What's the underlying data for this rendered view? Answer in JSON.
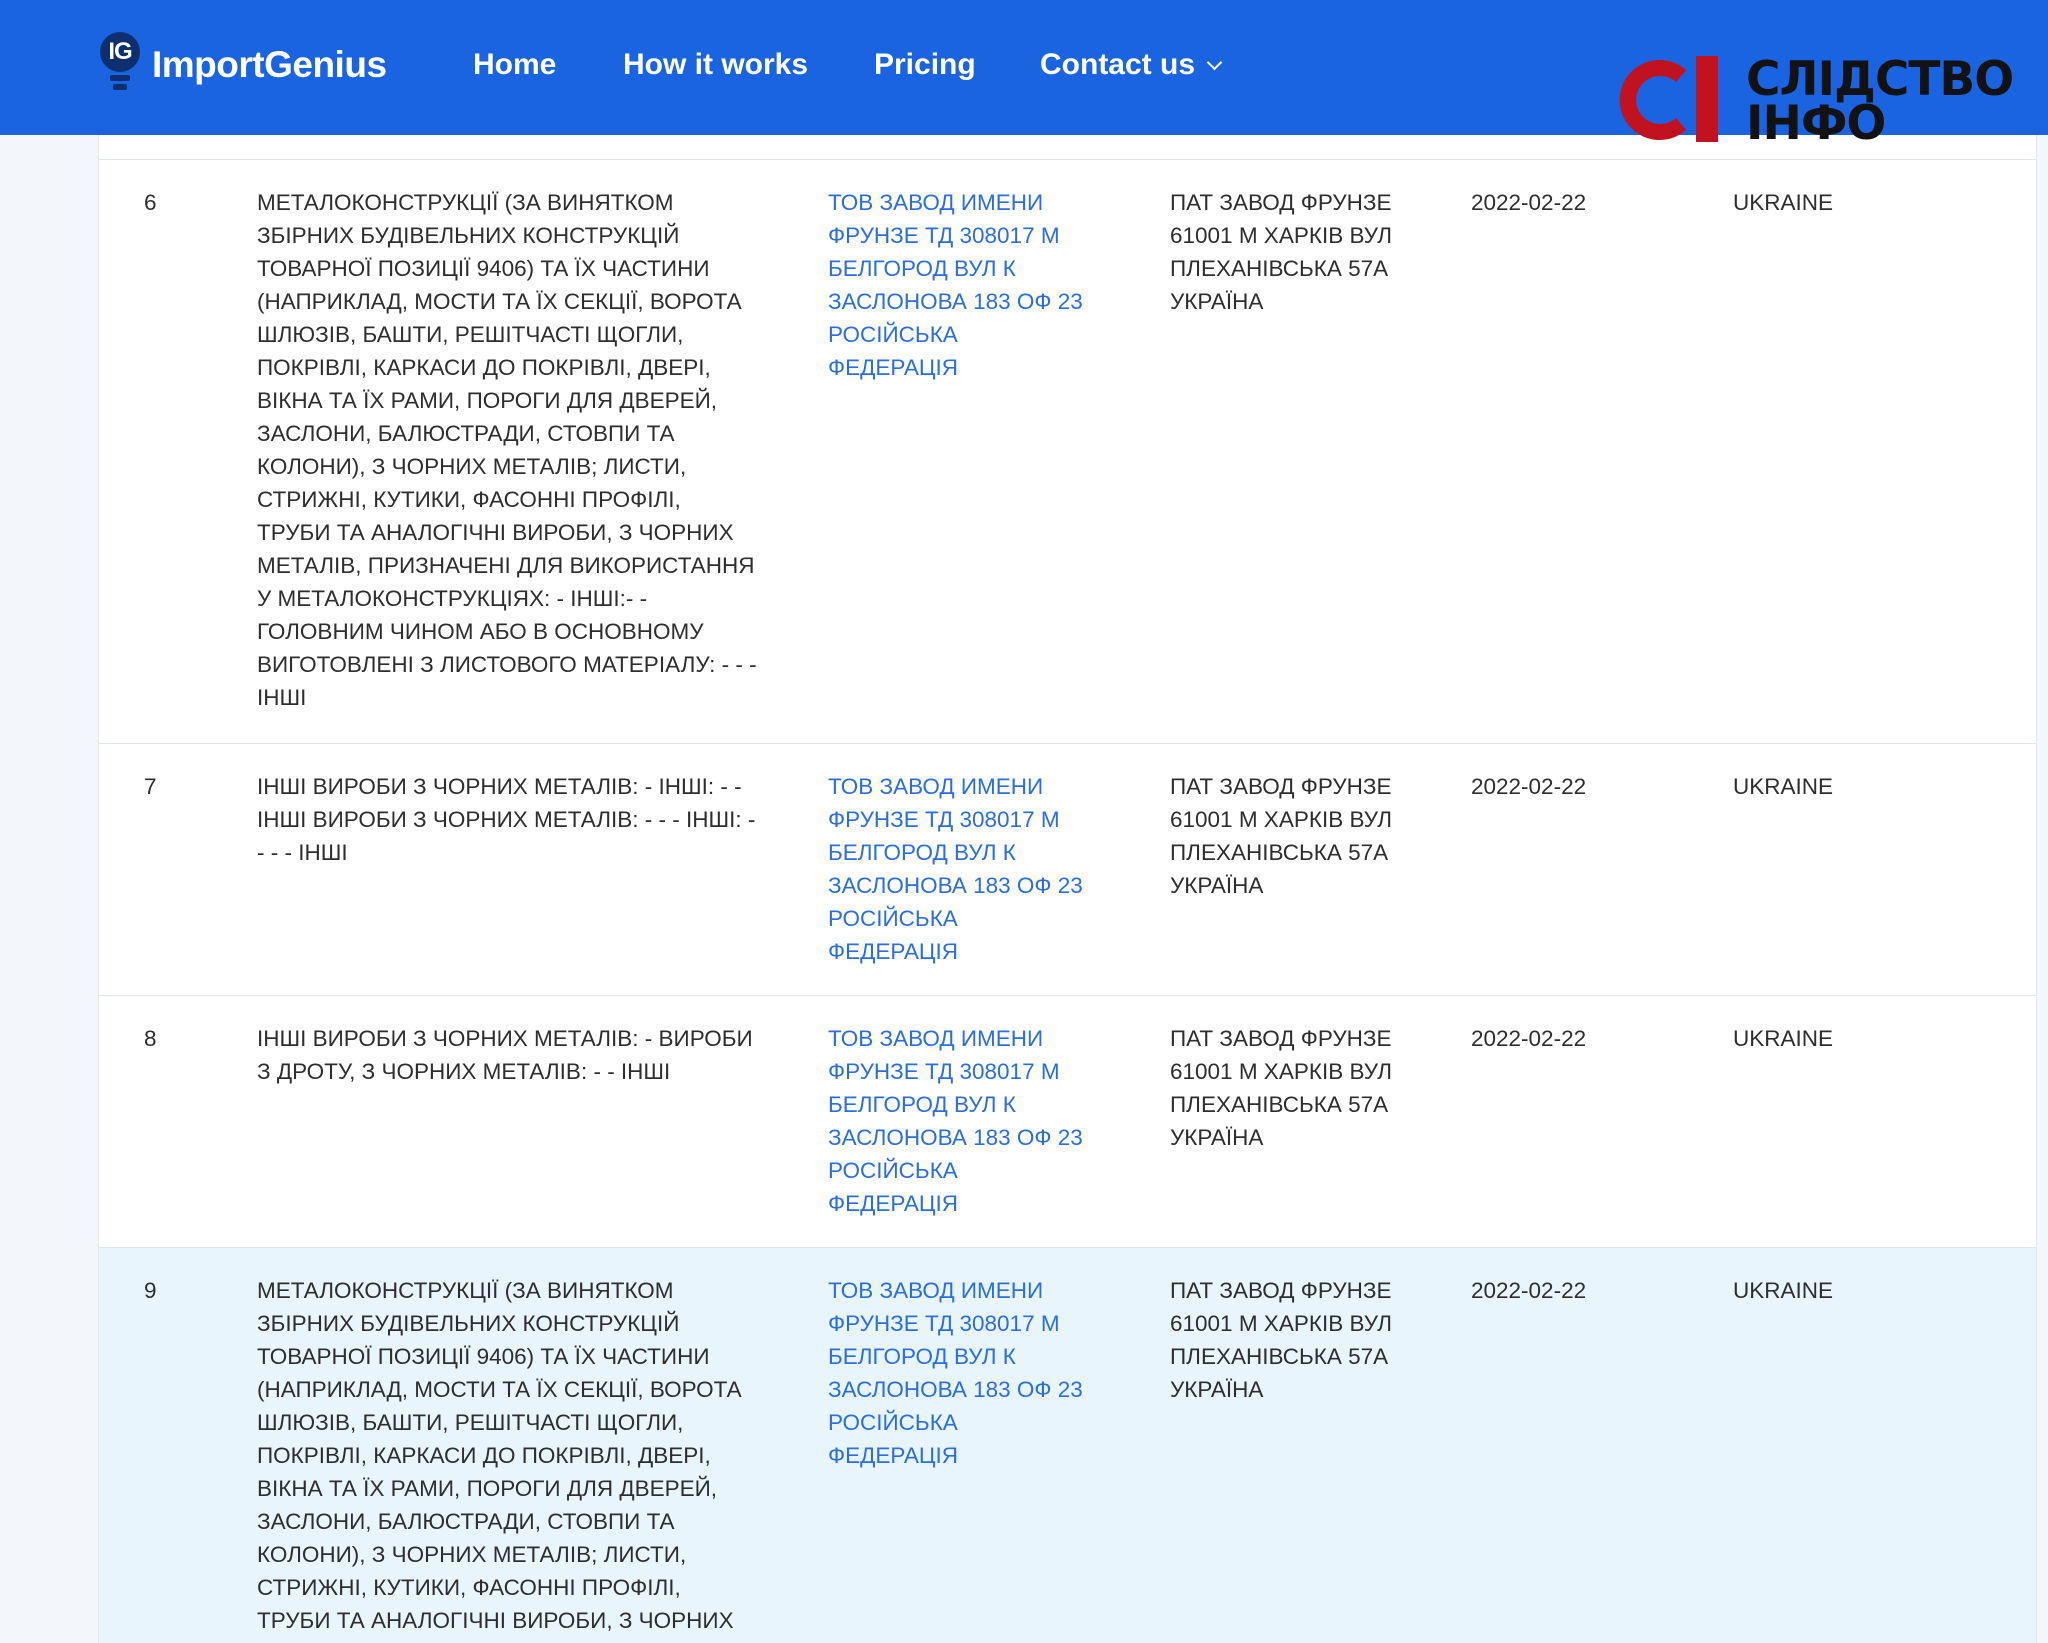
{
  "brand": {
    "badge": "IG",
    "name": "ImportGenius"
  },
  "nav": [
    {
      "label": "Home"
    },
    {
      "label": "How it works"
    },
    {
      "label": "Pricing"
    },
    {
      "label": "Contact us"
    }
  ],
  "watermark": {
    "line1": "СЛІДСТВО",
    "line2": "ІНФО",
    "accent_color": "#c1121f"
  },
  "colors": {
    "nav_bg": "#1a64e2",
    "link": "#2a6ee0",
    "highlight_row": "#e9f5fd"
  },
  "rows": [
    {
      "no": "6",
      "description": "МЕТАЛОКОНСТРУКЦІЇ (ЗА ВИНЯТКОМ ЗБІРНИХ БУДІВЕЛЬНИХ КОНСТРУКЦІЙ ТОВАРНОЇ ПОЗИЦІЇ 9406) ТА ЇХ ЧАСТИНИ (НАПРИКЛАД, МОСТИ ТА ЇХ СЕКЦІЇ, ВОРОТА ШЛЮЗІВ, БАШТИ, РЕШІТЧАСТІ ЩОГЛИ, ПОКРІВЛІ, КАРКАСИ ДО ПОКРІВЛІ, ДВЕРІ, ВІКНА ТА ЇХ РАМИ, ПОРОГИ ДЛЯ ДВЕРЕЙ, ЗАСЛОНИ, БАЛЮСТРАДИ, СТОВПИ ТА КОЛОНИ), З ЧОРНИХ МЕТАЛІВ; ЛИСТИ, СТРИЖНІ, КУТИКИ, ФАСОННІ ПРОФІЛІ, ТРУБИ ТА АНАЛОГІЧНІ ВИРОБИ, З ЧОРНИХ МЕТАЛІВ, ПРИЗНАЧЕНІ ДЛЯ ВИКОРИСТАННЯ У МЕТАЛОКОНСТРУКЦІЯХ: - ІНШІ:- - ГОЛОВНИМ ЧИНОМ АБО В ОСНОВНОМУ ВИГОТОВЛЕНІ З ЛИСТОВОГО МАТЕРІАЛУ: - - - ІНШІ",
      "shipper": "ТОВ ЗАВОД ИМЕНИ ФРУНЗЕ ТД 308017 М БЕЛГОРОД ВУЛ К ЗАСЛОНОВА 183 ОФ 23 РОСІЙСЬКА ФЕДЕРАЦІЯ",
      "consignee": "ПАТ ЗАВОД ФРУНЗЕ 61001 М ХАРКІВ ВУЛ ПЛЕХАНІВСЬКА 57А УКРАЇНА",
      "date": "2022-02-22",
      "country": "UKRAINE"
    },
    {
      "no": "7",
      "description": "ІНШІ ВИРОБИ З ЧОРНИХ МЕТАЛІВ: - ІНШІ: - - ІНШІ ВИРОБИ З ЧОРНИХ МЕТАЛІВ: - - - ІНШІ: - - - - ІНШІ",
      "shipper": "ТОВ ЗАВОД ИМЕНИ ФРУНЗЕ ТД 308017 М БЕЛГОРОД ВУЛ К ЗАСЛОНОВА 183 ОФ 23 РОСІЙСЬКА ФЕДЕРАЦІЯ",
      "consignee": "ПАТ ЗАВОД ФРУНЗЕ 61001 М ХАРКІВ ВУЛ ПЛЕХАНІВСЬКА 57А УКРАЇНА",
      "date": "2022-02-22",
      "country": "UKRAINE"
    },
    {
      "no": "8",
      "description": "ІНШІ ВИРОБИ З ЧОРНИХ МЕТАЛІВ: - ВИРОБИ З ДРОТУ, З ЧОРНИХ МЕТАЛІВ: - - ІНШІ",
      "shipper": "ТОВ ЗАВОД ИМЕНИ ФРУНЗЕ ТД 308017 М БЕЛГОРОД ВУЛ К ЗАСЛОНОВА 183 ОФ 23 РОСІЙСЬКА ФЕДЕРАЦІЯ",
      "consignee": "ПАТ ЗАВОД ФРУНЗЕ 61001 М ХАРКІВ ВУЛ ПЛЕХАНІВСЬКА 57А УКРАЇНА",
      "date": "2022-02-22",
      "country": "UKRAINE"
    },
    {
      "no": "9",
      "description": "МЕТАЛОКОНСТРУКЦІЇ (ЗА ВИНЯТКОМ ЗБІРНИХ БУДІВЕЛЬНИХ КОНСТРУКЦІЙ ТОВАРНОЇ ПОЗИЦІЇ 9406) ТА ЇХ ЧАСТИНИ (НАПРИКЛАД, МОСТИ ТА ЇХ СЕКЦІЇ, ВОРОТА ШЛЮЗІВ, БАШТИ, РЕШІТЧАСТІ ЩОГЛИ, ПОКРІВЛІ, КАРКАСИ ДО ПОКРІВЛІ, ДВЕРІ, ВІКНА ТА ЇХ РАМИ, ПОРОГИ ДЛЯ ДВЕРЕЙ, ЗАСЛОНИ, БАЛЮСТРАДИ, СТОВПИ ТА КОЛОНИ), З ЧОРНИХ МЕТАЛІВ; ЛИСТИ, СТРИЖНІ, КУТИКИ, ФАСОННІ ПРОФІЛІ, ТРУБИ ТА АНАЛОГІЧНІ ВИРОБИ, З ЧОРНИХ",
      "shipper": "ТОВ ЗАВОД ИМЕНИ ФРУНЗЕ ТД 308017 М БЕЛГОРОД ВУЛ К ЗАСЛОНОВА 183 ОФ 23 РОСІЙСЬКА ФЕДЕРАЦІЯ",
      "consignee": "ПАТ ЗАВОД ФРУНЗЕ 61001 М ХАРКІВ ВУЛ ПЛЕХАНІВСЬКА 57А УКРАЇНА",
      "date": "2022-02-22",
      "country": "UKRAINE"
    }
  ]
}
